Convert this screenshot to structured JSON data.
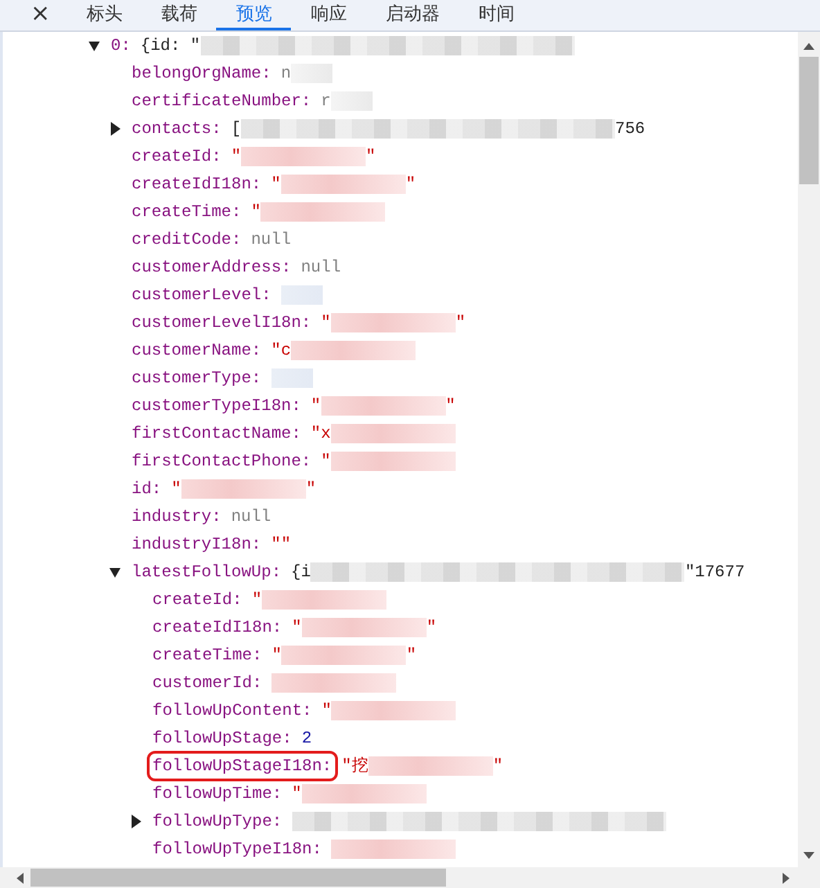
{
  "close_button": "×",
  "tabs": [
    {
      "label": "标头",
      "selected": false
    },
    {
      "label": "载荷",
      "selected": false
    },
    {
      "label": "预览",
      "selected": true
    },
    {
      "label": "响应",
      "selected": false
    },
    {
      "label": "启动器",
      "selected": false
    },
    {
      "label": "时间",
      "selected": false
    }
  ],
  "tree": [
    {
      "key": "0:",
      "expanded": true,
      "kind": "object",
      "value": "{id: \"",
      "redacted": true,
      "children": [
        {
          "key": "belongOrgName:",
          "kind": "null",
          "value": "n",
          "redacted": true
        },
        {
          "key": "certificateNumber:",
          "kind": "null",
          "value": "r",
          "redacted": true
        },
        {
          "key": "contacts:",
          "expanded": false,
          "kind": "object",
          "value": "[",
          "redacted": true,
          "tail": "756"
        },
        {
          "key": "createId:",
          "kind": "string",
          "value": "\"",
          "redacted": true,
          "tail": "\""
        },
        {
          "key": "createIdI18n:",
          "kind": "string",
          "value": "\"",
          "redacted": true,
          "tail": "\""
        },
        {
          "key": "createTime:",
          "kind": "string",
          "value": "\"",
          "redacted": true
        },
        {
          "key": "creditCode:",
          "kind": "null",
          "value": "null"
        },
        {
          "key": "customerAddress:",
          "kind": "null",
          "value": "null"
        },
        {
          "key": "customerLevel:",
          "kind": "number",
          "redacted": true
        },
        {
          "key": "customerLevelI18n:",
          "kind": "string",
          "value": "\"",
          "redacted": true,
          "tail": "\""
        },
        {
          "key": "customerName:",
          "kind": "string",
          "value": "\"c",
          "redacted": true
        },
        {
          "key": "customerType:",
          "kind": "number",
          "redacted": true
        },
        {
          "key": "customerTypeI18n:",
          "kind": "string",
          "value": "\"",
          "redacted": true,
          "tail": "\""
        },
        {
          "key": "firstContactName:",
          "kind": "string",
          "value": "\"x",
          "redacted": true
        },
        {
          "key": "firstContactPhone:",
          "kind": "string",
          "value": "\"",
          "redacted": true
        },
        {
          "key": "id:",
          "kind": "string",
          "value": "\"",
          "redacted": true,
          "tail": "\""
        },
        {
          "key": "industry:",
          "kind": "null",
          "value": "null"
        },
        {
          "key": "industryI18n:",
          "kind": "string",
          "value": "\"\""
        },
        {
          "key": "latestFollowUp:",
          "expanded": true,
          "kind": "object",
          "value": "{i",
          "redacted": true,
          "tail": "\"17677",
          "children": [
            {
              "key": "createId:",
              "kind": "string",
              "value": "\"",
              "redacted": true
            },
            {
              "key": "createIdI18n:",
              "kind": "string",
              "value": "\"",
              "redacted": true,
              "tail": "\""
            },
            {
              "key": "createTime:",
              "kind": "string",
              "value": "\"",
              "redacted": true,
              "tail": "\""
            },
            {
              "key": "customerId:",
              "kind": "string",
              "redacted": true
            },
            {
              "key": "followUpContent:",
              "kind": "string",
              "value": "\"",
              "redacted": true
            },
            {
              "key": "followUpStage:",
              "kind": "number",
              "value": "2"
            },
            {
              "key": "followUpStageI18n:",
              "kind": "string",
              "value": "\"挖",
              "redacted": true,
              "tail": "\"",
              "highlighted": true
            },
            {
              "key": "followUpTime:",
              "kind": "string",
              "value": "\"",
              "redacted": true
            },
            {
              "key": "followUpType:",
              "expanded": false,
              "kind": "object",
              "redacted": true
            },
            {
              "key": "followUpTypeI18n:",
              "kind": "string",
              "redacted": true
            }
          ]
        }
      ]
    }
  ]
}
